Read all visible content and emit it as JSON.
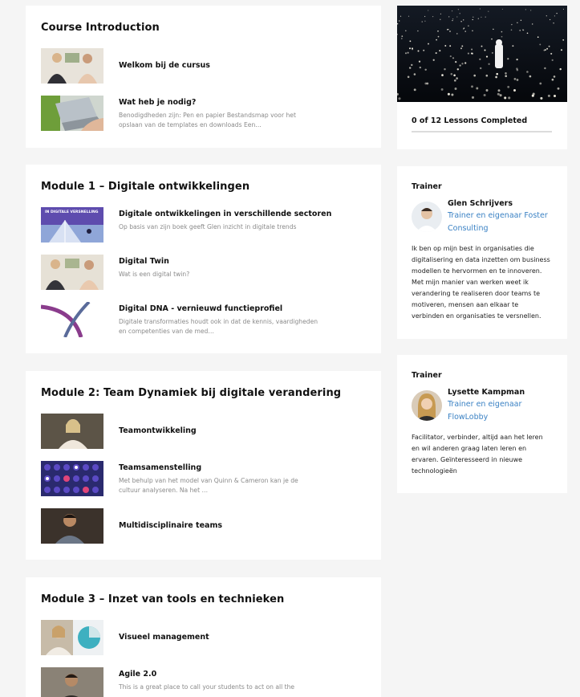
{
  "modules": [
    {
      "title": "Course Introduction",
      "lessons": [
        {
          "title": "Welkom bij de cursus",
          "desc": "",
          "thumb": "welcome-thumbnail"
        },
        {
          "title": "Wat heb je nodig?",
          "desc": "Benodigdheden zijn: Pen en papier Bestandsmap voor het opslaan van de templates en downloads Een…",
          "thumb": "laptop-thumbnail"
        }
      ]
    },
    {
      "title": "Module 1 – Digitale ontwikkelingen",
      "lessons": [
        {
          "title": "Digitale ontwikkelingen in verschillende sectoren",
          "desc": "Op basis van zijn boek geeft Glen inzicht in digitale trends",
          "thumb": "book-cover-thumbnail",
          "thumb_text": "IN DIGITALE VERSNELLING"
        },
        {
          "title": "Digital Twin",
          "desc": "Wat is een digital twin?",
          "thumb": "digital-twin-thumbnail"
        },
        {
          "title": "Digital DNA - vernieuwd functieprofiel",
          "desc": " Digitale transformaties houdt ook in dat de kennis, vaardigheden en competenties van de med…",
          "thumb": "dna-thumbnail"
        }
      ]
    },
    {
      "title": "Module 2: Team Dynamiek bij digitale verandering",
      "lessons": [
        {
          "title": "Teamontwikkeling",
          "desc": "",
          "thumb": "teamontwikkeling-thumbnail"
        },
        {
          "title": "Teamsamenstelling",
          "desc": "Met behulp van het model van Quinn & Cameron kan je de cultuur analyseren.  Na het …",
          "thumb": "teamsamenstelling-thumbnail"
        },
        {
          "title": "Multidisciplinaire teams",
          "desc": "",
          "thumb": "multidisciplinaire-thumbnail"
        }
      ]
    },
    {
      "title": "Module 3 – Inzet van tools en technieken",
      "lessons": [
        {
          "title": "Visueel management",
          "desc": "",
          "thumb": "visueel-management-thumbnail"
        },
        {
          "title": "Agile 2.0",
          "desc": "This is a great place to call your students to act on all the",
          "thumb": "agile-thumbnail"
        }
      ]
    }
  ],
  "progress": {
    "text": "0 of 12 Lessons Completed",
    "completed": 0,
    "total": 12
  },
  "trainers": [
    {
      "label": "Trainer",
      "name": "Glen Schrijvers",
      "role": "Trainer en eigenaar Foster Consulting",
      "bio": "Ik ben op mijn best in organisaties die digitalisering en data inzetten om business modellen te hervormen en te innoveren. Met mijn manier van werken weet ik verandering te realiseren door teams te motiveren, mensen aan elkaar te verbinden en organisaties te versnellen."
    },
    {
      "label": "Trainer",
      "name": "Lysette Kampman",
      "role": "Trainer en eigenaar FlowLobby",
      "bio": "Facilitator, verbinder, altijd aan het leren en wil anderen graag laten leren en ervaren. Geïnteresseerd in nieuwe technologieën"
    }
  ],
  "colors": {
    "accent": "#3b82c4",
    "card": "#ffffff",
    "background": "#f5f5f5"
  }
}
